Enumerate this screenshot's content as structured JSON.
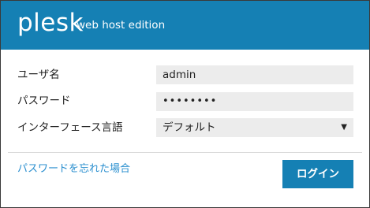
{
  "header": {
    "logo": "plesk",
    "edition": "web host edition"
  },
  "form": {
    "username": {
      "label": "ユーザ名",
      "value": "admin"
    },
    "password": {
      "label": "パスワード",
      "value": "••••••••"
    },
    "language": {
      "label": "インターフェース言語",
      "value": "デフォルト"
    }
  },
  "footer": {
    "forgot_link": "パスワードを忘れた場合",
    "login_button": "ログイン"
  },
  "colors": {
    "brand": "#1580b4",
    "link": "#2a8fcf",
    "field_bg": "#ececec"
  },
  "icons": {
    "dropdown": "caret-down-icon"
  }
}
